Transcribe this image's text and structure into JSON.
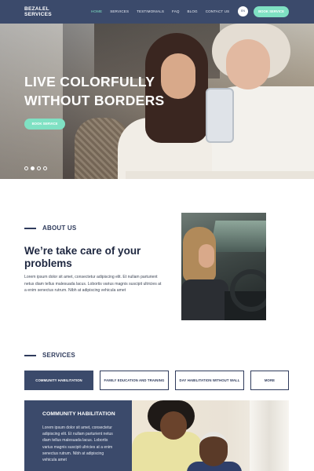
{
  "header": {
    "logo_line1": "BEZALEL",
    "logo_line2": "SERVICES",
    "nav": [
      {
        "label": "HOME",
        "active": true
      },
      {
        "label": "SERVICES",
        "active": false
      },
      {
        "label": "TESTIMONIALS",
        "active": false
      },
      {
        "label": "FAQ",
        "active": false
      },
      {
        "label": "BLOG",
        "active": false
      },
      {
        "label": "CONTACT US",
        "active": false
      }
    ],
    "lang": "EN",
    "book_label": "BOOK SERVICE"
  },
  "hero": {
    "title_line1": "LIVE COLORFULLY",
    "title_line2": "WITHOUT BORDERS",
    "button_label": "BOOK SERVICE",
    "slides": 4,
    "active_slide": 2
  },
  "about": {
    "label": "ABOUT US",
    "heading_line1": "We’re take care of your",
    "heading_line2": "problems",
    "text": "Lorem ipsum dolor sit amet, consectetur adipiscing elit. Et nullam parturient netus diam tellus malesuada lacus. Lobortis varius magnis suscipit ultricies at a enim senectus rutrum. Nibh at adipiscing vehicula amet"
  },
  "services": {
    "label": "SERVICES",
    "tabs": [
      {
        "label": "COMMUNITY HABILITATION",
        "active": true
      },
      {
        "label": "FAMILY EDUCATION AND TRAINING",
        "active": false
      },
      {
        "label": "DAY HABILITATION WITHOUT WALL",
        "active": false
      },
      {
        "label": "MORE",
        "active": false
      }
    ],
    "panel_title": "COMMUNITY HABILITATION",
    "panel_text": "Lorem ipsum dolor sit amet, consectetur adipiscing elit. Et nullam parturient netus diam tellus malesuada lacus. Lobortis varius magnis suscipit ultricies at a enim senectus rutrum. Nibh at adipiscing vehicula amet"
  },
  "colors": {
    "navy": "#3b4a6b",
    "mint": "#7fe1c3",
    "text_dark": "#1e2740"
  }
}
